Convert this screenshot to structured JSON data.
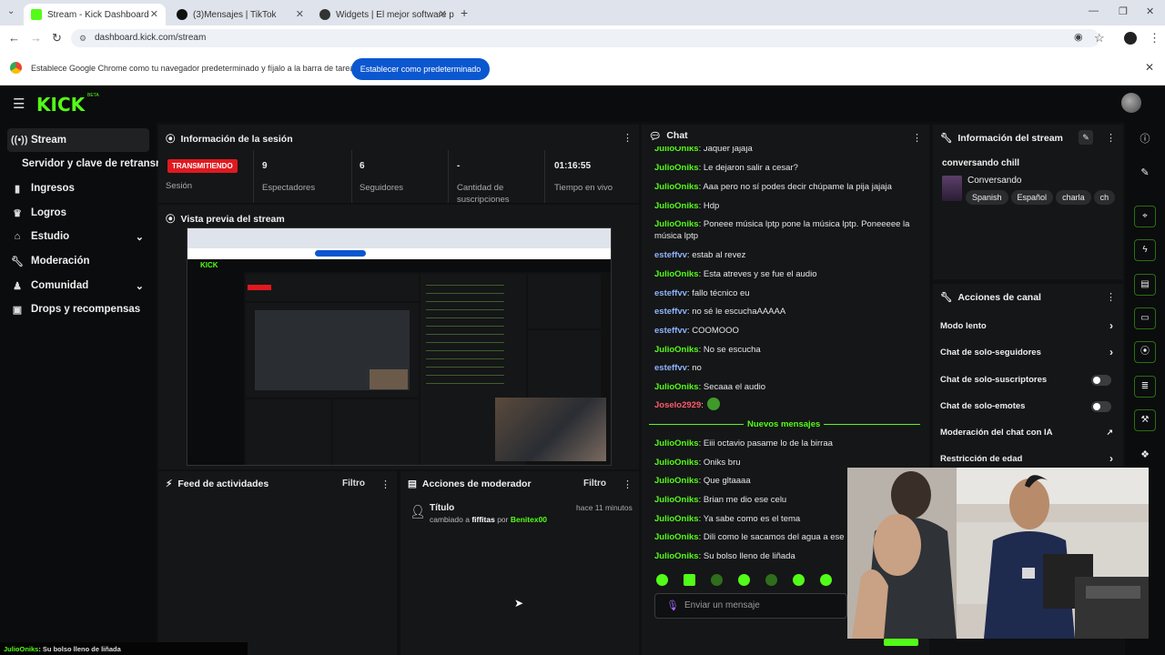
{
  "browser": {
    "tabs": [
      {
        "title": "Stream - Kick Dashboard",
        "active": true
      },
      {
        "title": "(3)Mensajes | TikTok",
        "active": false
      },
      {
        "title": "Widgets | El mejor software pa",
        "active": false
      }
    ],
    "url": "dashboard.kick.com/stream",
    "infobar_message": "Establece Google Chrome como tu navegador predeterminado y fíjalo a la barra de tareas",
    "infobar_button": "Establecer como predeterminado"
  },
  "kick": {
    "logo": "KICK",
    "beta": "BETA"
  },
  "sidebar": {
    "items": [
      {
        "label": "Stream",
        "icon": "broadcast-icon"
      },
      {
        "label": "Ingresos",
        "icon": "chart-icon"
      },
      {
        "label": "Logros",
        "icon": "trophy-icon"
      },
      {
        "label": "Estudio",
        "icon": "studio-icon"
      },
      {
        "label": "Moderación",
        "icon": "wrench-icon"
      },
      {
        "label": "Comunidad",
        "icon": "community-icon"
      },
      {
        "label": "Drops y recompensas",
        "icon": "drops-icon"
      }
    ],
    "sub_item": "Servidor y clave de retransmisión"
  },
  "session": {
    "title": "Información de la sesión",
    "status": "TRANSMITIENDO",
    "status_label": "Sesión",
    "stats": [
      {
        "value": "9",
        "label": "Espectadores"
      },
      {
        "value": "6",
        "label": "Seguidores"
      },
      {
        "value": "-",
        "label": "Cantidad de suscripciones"
      },
      {
        "value": "01:16:55",
        "label": "Tiempo en vivo"
      }
    ]
  },
  "preview": {
    "title": "Vista previa del stream"
  },
  "activity": {
    "title": "Feed de actividades",
    "filter": "Filtro"
  },
  "modactions": {
    "title": "Acciones de moderador",
    "filter": "Filtro",
    "entry": {
      "title": "Título",
      "time": "hace 11 minutos",
      "changed": "cambiado a",
      "value": "fiffitas",
      "by": "por",
      "user": "Benitex00"
    }
  },
  "chat": {
    "title": "Chat",
    "messages": [
      {
        "user": "JulioOniks",
        "text": "Jaquer jajaja",
        "color": "green"
      },
      {
        "user": "JulioOniks",
        "text": "Le dejaron salir a cesar?",
        "color": "green"
      },
      {
        "user": "JulioOniks",
        "text": "Aaa pero no sí podes decir chúpame la pija jajaja",
        "color": "green"
      },
      {
        "user": "JulioOniks",
        "text": "Hdp",
        "color": "green"
      },
      {
        "user": "JulioOniks",
        "text": "Poneee música lptp pone la música lptp. Poneeeee la música lptp",
        "color": "green"
      },
      {
        "user": "esteffvv",
        "text": "estab al revez",
        "color": "blue"
      },
      {
        "user": "JulioOniks",
        "text": "Esta atreves y se fue el audio",
        "color": "green"
      },
      {
        "user": "esteffvv",
        "text": "fallo técnico eu",
        "color": "blue"
      },
      {
        "user": "esteffvv",
        "text": "no sé le escuchaAAAAA",
        "color": "blue"
      },
      {
        "user": "esteffvv",
        "text": "COOMOOO",
        "color": "blue"
      },
      {
        "user": "JulioOniks",
        "text": "No se escucha",
        "color": "green"
      },
      {
        "user": "esteffvv",
        "text": "no",
        "color": "blue"
      },
      {
        "user": "JulioOniks",
        "text": "Secaaa el audio",
        "color": "green"
      },
      {
        "user": "Joselo2929",
        "text": "",
        "color": "red"
      }
    ],
    "new_messages_label": "Nuevos mensajes",
    "new_messages": [
      {
        "user": "JulioOniks",
        "text": "Eiii octavio pasame lo de la birraa"
      },
      {
        "user": "JulioOniks",
        "text": "Oniks bru"
      },
      {
        "user": "JulioOniks",
        "text": "Que gltaaaa"
      },
      {
        "user": "JulioOniks",
        "text": "Brian me dio ese celu"
      },
      {
        "user": "JulioOniks",
        "text": "Ya sabe como es el tema"
      },
      {
        "user": "JulioOniks",
        "text": "Dili como le sacamos del agua a ese"
      },
      {
        "user": "JulioOniks",
        "text": "Su bolso lleno de liñada"
      }
    ],
    "input_placeholder": "Enviar un mensaje"
  },
  "stream_info": {
    "title": "Información del stream",
    "stream_title": "conversando chill",
    "category": "Conversando",
    "tags": [
      "Spanish",
      "Español",
      "charla",
      "ch"
    ]
  },
  "channel_actions": {
    "title": "Acciones de canal",
    "items": [
      {
        "label": "Modo lento",
        "control": "chevron"
      },
      {
        "label": "Chat de solo-seguidores",
        "control": "chevron"
      },
      {
        "label": "Chat de solo-suscriptores",
        "control": "toggle"
      },
      {
        "label": "Chat de solo-emotes",
        "control": "toggle"
      },
      {
        "label": "Moderación del chat con IA",
        "control": "external"
      },
      {
        "label": "Restricción de edad",
        "control": "chevron"
      }
    ]
  },
  "bottom_overlay": {
    "user": "JulioOniks",
    "text": ": Su bolso lleno de liñada"
  },
  "colors": {
    "kick_green": "#53fc18",
    "live_red": "#e0191f",
    "panel_bg": "#151617",
    "chrome_button": "#0b57d0"
  }
}
